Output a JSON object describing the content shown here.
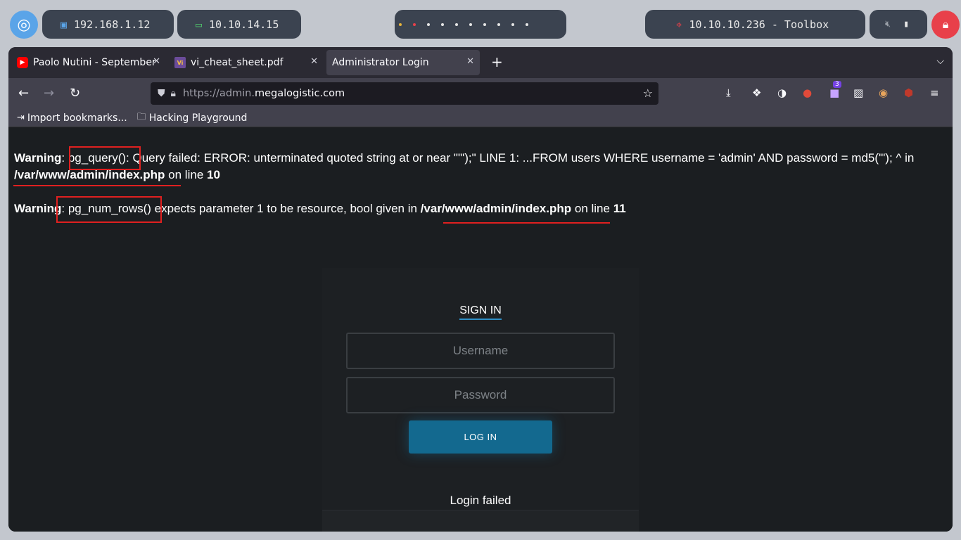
{
  "sysbar": {
    "ip_local": "192.168.1.12",
    "ip_vpn": "10.10.14.15",
    "target": "10.10.10.236 - Toolbox",
    "workspace_dots": 10,
    "colors": {
      "accent_blue": "#5aa4e8",
      "lock_red": "#e8404a",
      "pill_bg": "#3b4350"
    }
  },
  "browser": {
    "tabs": [
      {
        "label": "Paolo Nutini - September",
        "icon": "youtube-icon"
      },
      {
        "label": "vi_cheat_sheet.pdf",
        "icon": "pdf-icon"
      },
      {
        "label": "Administrator Login",
        "icon": "",
        "active": true
      }
    ],
    "url": {
      "scheme": "https://admin.",
      "domain": "megalogistic.com"
    },
    "extension_badge": "3",
    "bookmarks": [
      {
        "label": "Import bookmarks...",
        "icon": "import-icon"
      },
      {
        "label": "Hacking Playground",
        "icon": "folder-icon"
      }
    ]
  },
  "page": {
    "warning1": {
      "prefix": "Warning",
      "func": "pg_query():",
      "message": "Query failed: ERROR: unterminated quoted string at or near \"'\");\" LINE 1: ...FROM users WHERE username = 'admin' AND password = md5('\"); ^ in",
      "path": "/var/www/admin/index.php",
      "online": "on line",
      "line": "10"
    },
    "warning2": {
      "prefix": "Warning",
      "func": "pg_num_rows()",
      "message": "expects parameter 1 to be resource, bool given in",
      "path": "/var/www/admin/index.php",
      "online": "on line",
      "line": "11"
    },
    "login": {
      "title": "SIGN IN",
      "username_placeholder": "Username",
      "password_placeholder": "Password",
      "button": "LOG IN",
      "status": "Login failed"
    },
    "colors": {
      "highlight": "#e02020",
      "button": "#13698f",
      "underline": "#2e8fc6"
    }
  }
}
